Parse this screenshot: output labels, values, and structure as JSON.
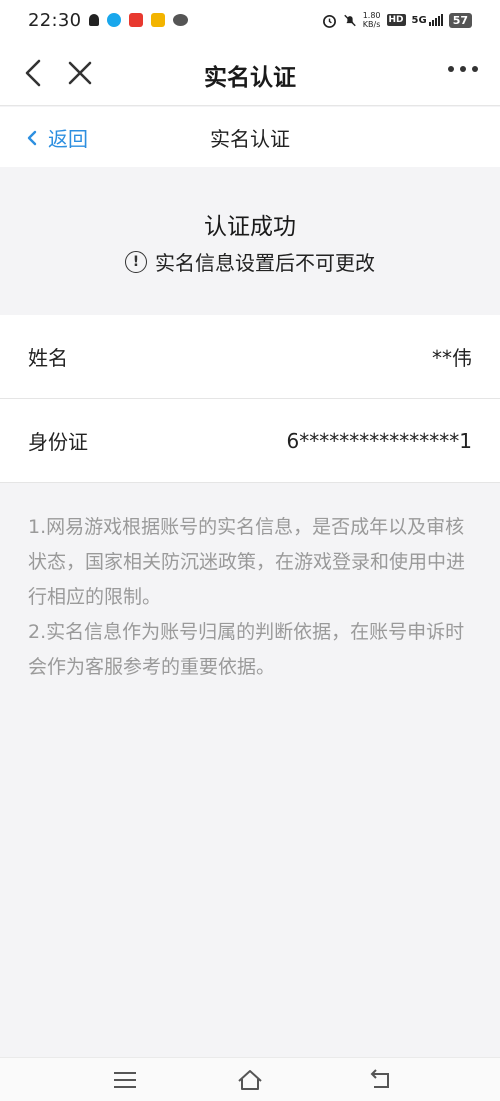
{
  "status_bar": {
    "time": "22:30",
    "speed_value": "1.80",
    "speed_unit": "KB/s",
    "hd": "HD",
    "network": "5G",
    "battery": "57"
  },
  "top_bar": {
    "title": "实名认证"
  },
  "nav_bar": {
    "back_label": "返回",
    "title": "实名认证"
  },
  "result": {
    "title": "认证成功",
    "note": "实名信息设置后不可更改",
    "note_icon_glyph": "!"
  },
  "info_rows": [
    {
      "label": "姓名",
      "value": "**伟"
    },
    {
      "label": "身份证",
      "value": "6****************1"
    }
  ],
  "notes": [
    "1.网易游戏根据账号的实名信息，是否成年以及审核状态，国家相关防沉迷政策，在游戏登录和使用中进行相应的限制。",
    "2.实名信息作为账号归属的判断依据，在账号申诉时会作为客服参考的重要依据。"
  ],
  "colors": {
    "accent": "#2d8fe0",
    "background": "#f4f4f6",
    "note_text": "#9a9a9a"
  }
}
